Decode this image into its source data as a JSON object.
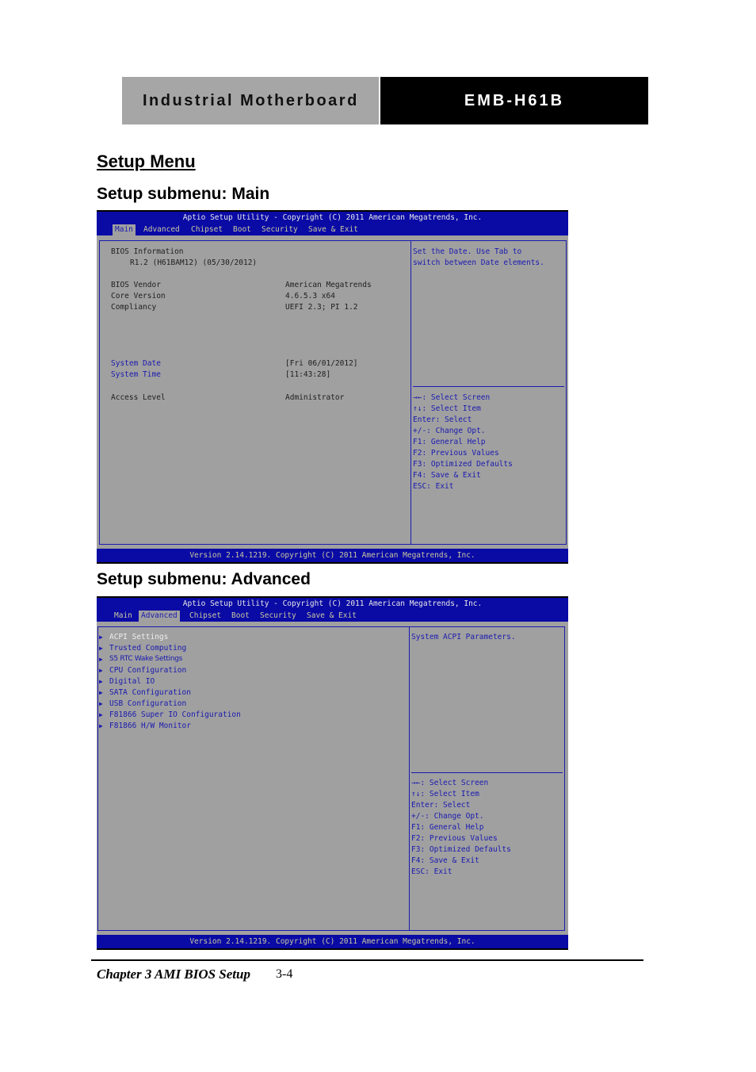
{
  "header": {
    "left": "Industrial Motherboard",
    "right": "EMB-H61B"
  },
  "section_title": "Setup Menu",
  "main_title": "Setup submenu: Main",
  "advanced_title": "Setup submenu: Advanced",
  "bios_common": {
    "title": "Aptio Setup Utility - Copyright (C) 2011 American Megatrends, Inc.",
    "tabs": [
      "Main",
      "Advanced",
      "Chipset",
      "Boot",
      "Security",
      "Save & Exit"
    ],
    "footer": "Version 2.14.1219. Copyright (C) 2011 American Megatrends, Inc.",
    "keys": [
      "→←: Select Screen",
      "↑↓: Select Item",
      "Enter: Select",
      "+/-: Change Opt.",
      "F1: General Help",
      "F2: Previous Values",
      "F3: Optimized Defaults",
      "F4: Save & Exit",
      "ESC: Exit"
    ]
  },
  "main": {
    "bios_info_label": "BIOS Information",
    "bios_info_value": "R1.2 (H61BAM12) (05/30/2012)",
    "rows": [
      {
        "label": "BIOS Vendor",
        "value": "American Megatrends"
      },
      {
        "label": "Core Version",
        "value": "4.6.5.3 x64"
      },
      {
        "label": "Compliancy",
        "value": "UEFI 2.3; PI 1.2"
      }
    ],
    "system_date_label": "System Date",
    "system_date_value": "[Fri 06/01/2012]",
    "system_time_label": "System Time",
    "system_time_value": "[11:43:28]",
    "access_level_label": "Access Level",
    "access_level_value": "Administrator",
    "help": [
      "Set the Date. Use Tab to",
      "switch between Date elements."
    ]
  },
  "advanced": {
    "items": [
      "ACPI Settings",
      "Trusted Computing",
      "S5 RTC Wake Settings",
      "CPU Configuration",
      "Digital IO",
      "SATA Configuration",
      "USB Configuration",
      "F81866 Super IO Configuration",
      "F81866 H/W Monitor"
    ],
    "help": "System ACPI Parameters."
  },
  "page_footer": {
    "chapter": "Chapter 3 AMI BIOS Setup",
    "page": "3-4"
  }
}
